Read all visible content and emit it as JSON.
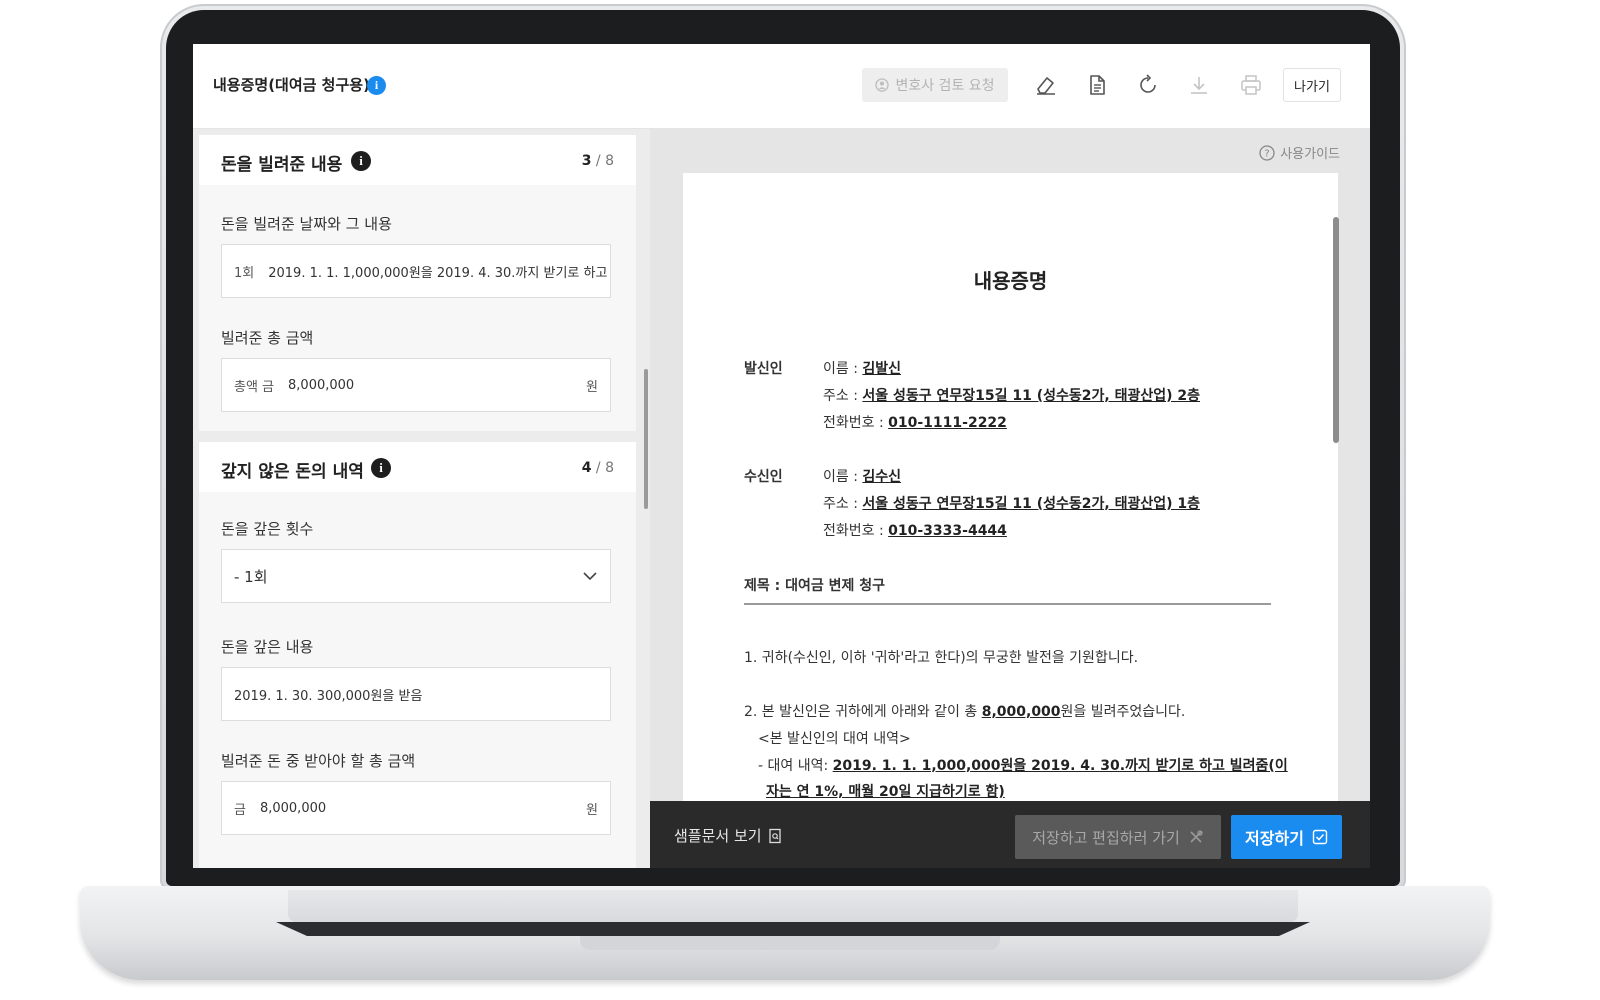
{
  "header": {
    "title": "내용증명(대여금 청구용)",
    "review_button": "변호사 검토 요청",
    "exit_button": "나가기"
  },
  "left": {
    "section1": {
      "title": "돈을 빌려준 내용",
      "step_current": "3",
      "step_total": "/ 8",
      "field1_label": "돈을 빌려준 날짜와 그 내용",
      "field1_prefix": "1회",
      "field1_value": "2019. 1. 1. 1,000,000원을 2019. 4. 30.까지 받기로 하고",
      "field2_label": "빌려준 총 금액",
      "field2_prefix": "총액 금",
      "field2_value": "8,000,000",
      "field2_unit": "원"
    },
    "section2": {
      "title": "갚지 않은 돈의 내역",
      "step_current": "4",
      "step_total": "/ 8",
      "field1_label": "돈을 갚은 횟수",
      "field1_value": "- 1회",
      "field2_label": "돈을 갚은 내용",
      "field2_value": "2019. 1. 30. 300,000원을 받음",
      "field3_label": "빌려준 돈 중 받아야 할 총 금액",
      "field3_prefix": "금",
      "field3_value": "8,000,000",
      "field3_unit": "원"
    }
  },
  "preview": {
    "guide": "사용가이드",
    "doc_title": "내용증명",
    "sender": {
      "label": "발신인",
      "name_label": "이름 :",
      "name": "김발신",
      "address_label": "주소 :",
      "address": "서울 성동구 연무장15길 11 (성수동2가, 태광산업) 2층",
      "phone_label": "전화번호 :",
      "phone": "010-1111-2222"
    },
    "receiver": {
      "label": "수신인",
      "name_label": "이름 :",
      "name": "김수신",
      "address_label": "주소 :",
      "address": "서울 성동구 연무장15길 11 (성수동2가, 태광산업) 1층",
      "phone_label": "전화번호 :",
      "phone": "010-3333-4444"
    },
    "subject": "제목 : 대여금 변제 청구",
    "para1": "1. 귀하(수신인, 이하 '귀하'라고 한다)의 무궁한 발전을 기원합니다.",
    "para2_pre": "2. 본 발신인은 귀하에게 아래와 같이 총 ",
    "para2_amount": "8,000,000",
    "para2_post": "원을 빌려주었습니다.",
    "loan_header": "<본 발신인의 대여 내역>",
    "loan_label": "- 대여 내역: ",
    "loan_detail": "2019. 1. 1. 1,000,000원을 2019. 4. 30.까지 받기로 하고 빌려줌(이",
    "loan_detail2": "자는 연 1%, 매월 20일 지급하기로 함)"
  },
  "footer": {
    "sample": "샘플문서 보기",
    "save_edit": "저장하고 편집하러 가기",
    "save": "저장하기"
  },
  "colors": {
    "accent": "#1a8cf0",
    "bottom_bar": "#2a2a2a"
  }
}
